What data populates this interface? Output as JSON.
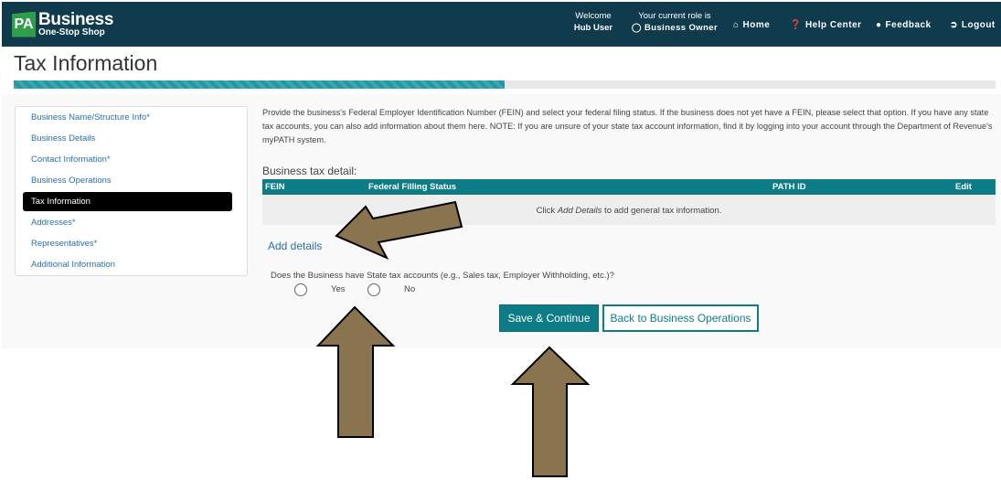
{
  "header": {
    "logo_pa": "PA",
    "logo_line1": "Business",
    "logo_line2": "One-Stop Shop",
    "welcome_label": "Welcome",
    "welcome_user": "Hub User",
    "role_label": "Your current role is",
    "role_value": "Business Owner",
    "nav": [
      {
        "label": "Home",
        "icon": "home-icon"
      },
      {
        "label": "Help Center",
        "icon": "question-circle-icon"
      },
      {
        "label": "Feedback",
        "icon": "comment-icon"
      },
      {
        "label": "Logout",
        "icon": "logout-icon"
      }
    ]
  },
  "page": {
    "title": "Tax Information",
    "progress_fraction": 0.5
  },
  "sidebar": {
    "items": [
      {
        "label": "Business Name/Structure Info*"
      },
      {
        "label": "Business Details"
      },
      {
        "label": "Contact Information*"
      },
      {
        "label": "Business Operations"
      },
      {
        "label": "Tax Information",
        "active": true
      },
      {
        "label": "Addresses*"
      },
      {
        "label": "Representatives*"
      },
      {
        "label": "Additional Information"
      }
    ]
  },
  "main": {
    "intro": "Provide the business's Federal Employer Identification Number (FEIN) and select your federal filing status. If the business does not yet have a FEIN, please select that option. If you have any state tax accounts, you can also add information about them here. NOTE: If you are unsure of your state tax account information, find it by logging into your account through the Department of Revenue's myPATH system.",
    "section_title": "Business tax detail:",
    "table": {
      "columns": [
        "FEIN",
        "Federal Filling Status",
        "PATH ID",
        "Edit"
      ],
      "empty_prefix": "Click ",
      "empty_link": "Add Details",
      "empty_suffix": " to add general tax information."
    },
    "add_details_label": "Add details",
    "question": "Does the Business have State tax accounts (e.g., Sales tax, Employer Withholding, etc.)?",
    "options": [
      "Yes",
      "No"
    ],
    "save_button": "Save & Continue",
    "back_button": "Back to Business Operations"
  },
  "colors": {
    "header_bg": "#0f3b4d",
    "teal": "#0e7c86",
    "link": "#2a6fae",
    "arrow": "#8a7450"
  }
}
